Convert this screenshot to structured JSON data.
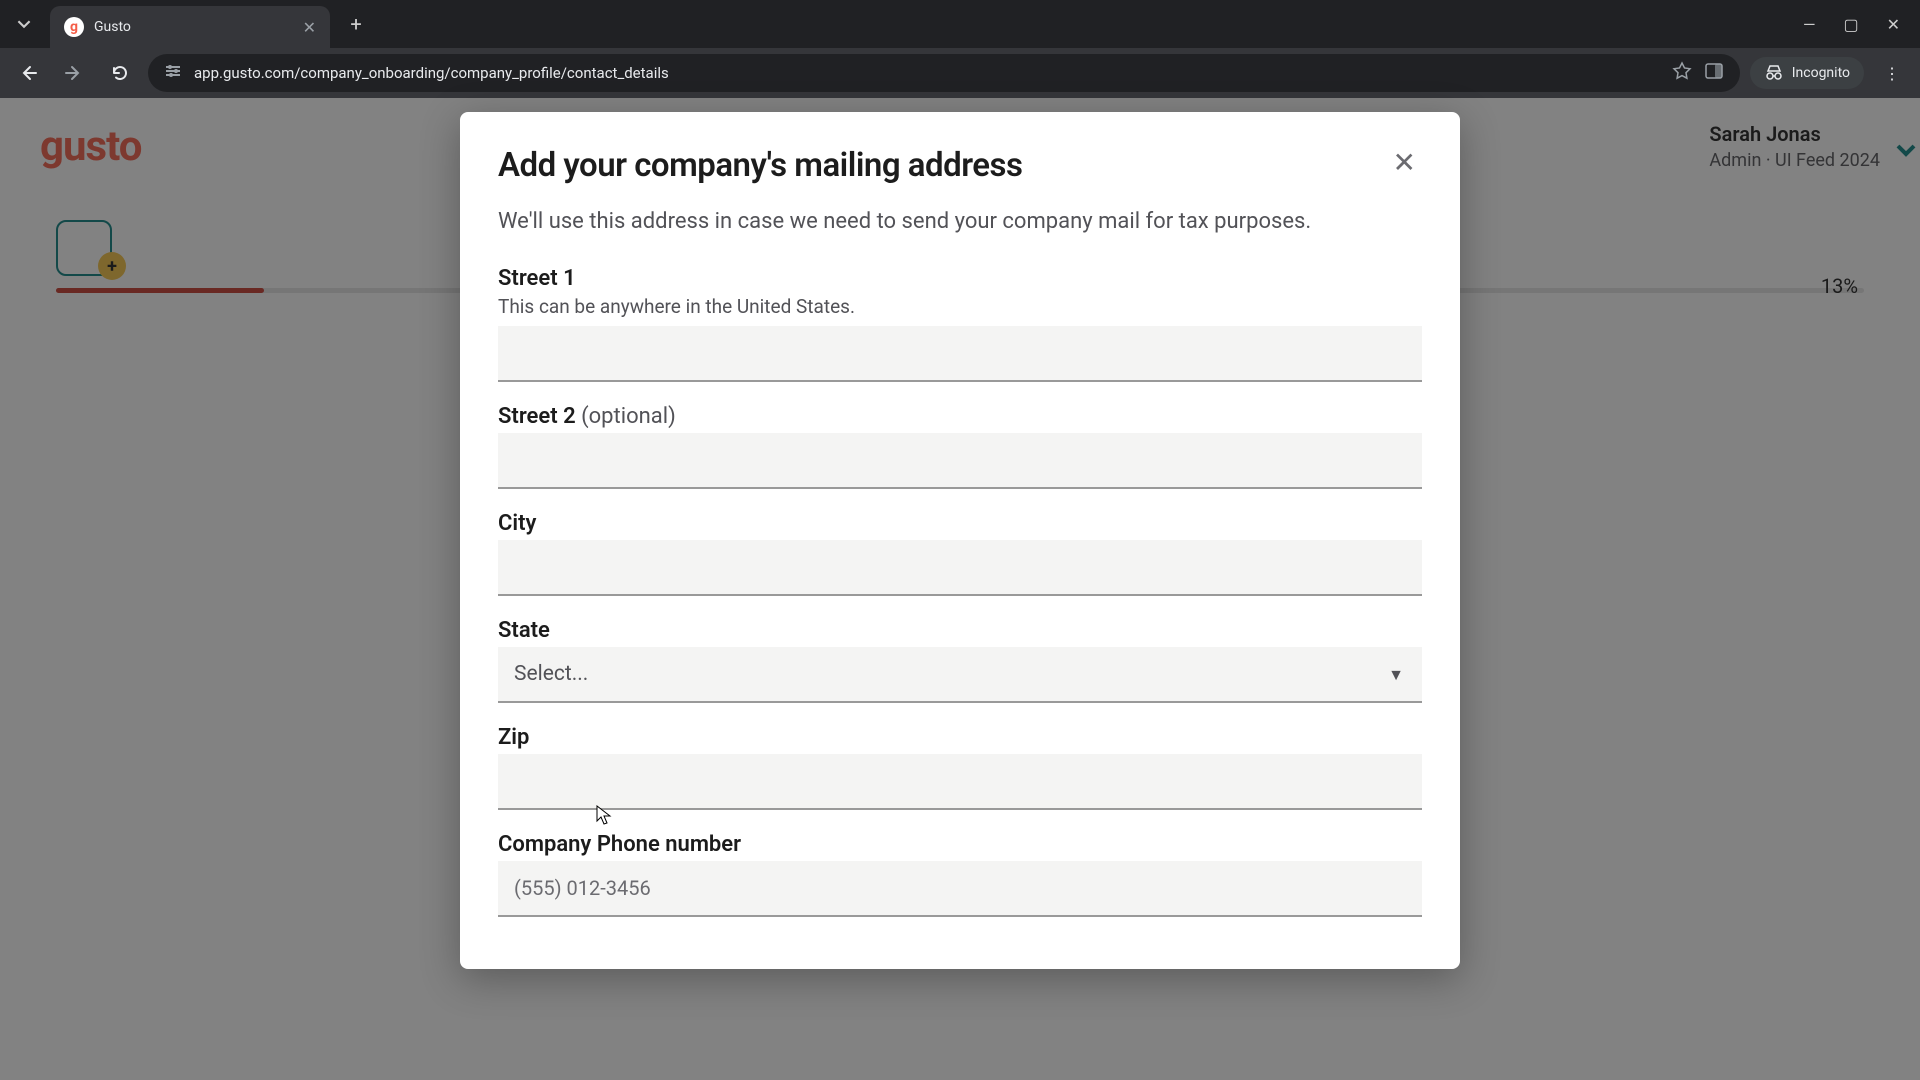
{
  "browser": {
    "tab_title": "Gusto",
    "favicon_letter": "g",
    "url": "app.gusto.com/company_onboarding/company_profile/contact_details",
    "incognito_label": "Incognito"
  },
  "page": {
    "logo_text": "gusto",
    "user_name": "Sarah Jonas",
    "user_subtitle": "Admin · UI Feed 2024",
    "progress_percent": "13%"
  },
  "modal": {
    "title": "Add your company's mailing address",
    "description": "We'll use this address in case we need to send your company mail for tax purposes.",
    "fields": {
      "street1": {
        "label": "Street 1",
        "help": "This can be anywhere in the United States.",
        "value": ""
      },
      "street2": {
        "label": "Street 2",
        "optional": "(optional)",
        "value": ""
      },
      "city": {
        "label": "City",
        "value": ""
      },
      "state": {
        "label": "State",
        "placeholder": "Select..."
      },
      "zip": {
        "label": "Zip",
        "value": ""
      },
      "phone": {
        "label": "Company Phone number",
        "placeholder": "(555) 012-3456",
        "value": ""
      }
    }
  }
}
